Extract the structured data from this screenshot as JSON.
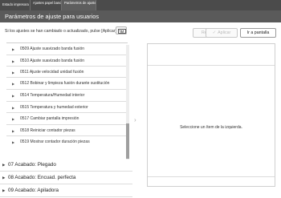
{
  "tabs": [
    {
      "label": "Estado impresora"
    },
    {
      "label": "Ajustes papel bandeja"
    },
    {
      "label": "Parámetros de ajuste para usuarios"
    }
  ],
  "header": {
    "title": "Parámetros de ajuste para usuarios"
  },
  "info": {
    "text": "Si los ajustes se han cambiado o actualizado, pulse [Aplicar]"
  },
  "buttons": {
    "restablecer": "Restablecer",
    "aplicar": "Aplicar",
    "ir_pantalla": "Ir a pantalla"
  },
  "list": {
    "items": [
      {
        "label": "0509 Ajuste suavizado banda fusión"
      },
      {
        "label": "0510 Ajuste suavizado banda fusión"
      },
      {
        "label": "0511 Ajuste velocidad unidad fusión"
      },
      {
        "label": "0512 Bobinar y limpieza fusión durante sustitución"
      },
      {
        "label": "0514 Temperatura/Humedad interior"
      },
      {
        "label": "0515 Temperatura y humedad exterior"
      },
      {
        "label": "0517 Cambiar pantalla impresión"
      },
      {
        "label": "0518 Reiniciar contador piezas"
      },
      {
        "label": "0519 Mostrar contador duración piezas"
      }
    ],
    "groups": [
      {
        "label": "07 Acabado: Plegado"
      },
      {
        "label": "08 Acabado: Encuad. perfecta"
      },
      {
        "label": "09 Acabado: Apiladora"
      }
    ]
  },
  "detail": {
    "message": "Seleccione un ítem de la izquierda."
  }
}
